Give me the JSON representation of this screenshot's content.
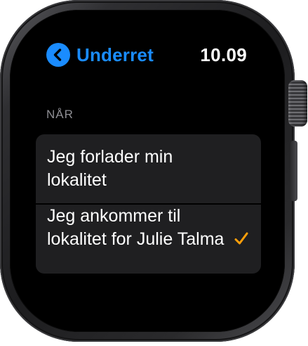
{
  "header": {
    "back_label": "Underret",
    "time": "10.09"
  },
  "section": {
    "title": "NÅR"
  },
  "options": [
    {
      "label": "Jeg forlader min lokalitet",
      "selected": false
    },
    {
      "label": "Jeg ankommer til lokalitet for Julie Talma",
      "selected": true
    }
  ],
  "colors": {
    "accent_blue": "#1a8cff",
    "check_orange": "#ff9f0a",
    "row_background": "#1f1f21",
    "header_gray": "#8e8e93"
  },
  "icons": {
    "back": "chevron-left-icon",
    "selected": "checkmark-icon"
  }
}
